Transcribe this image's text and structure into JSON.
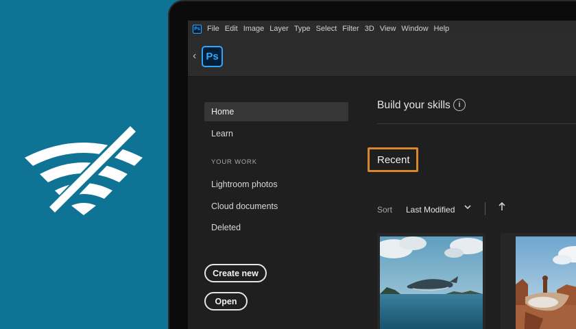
{
  "menubar": {
    "app_icon": "Ps",
    "items": [
      "File",
      "Edit",
      "Image",
      "Layer",
      "Type",
      "Select",
      "Filter",
      "3D",
      "View",
      "Window",
      "Help"
    ]
  },
  "appbar": {
    "logo_text": "Ps",
    "back_icon": "chevron-left-icon"
  },
  "sidebar": {
    "items": [
      {
        "label": "Home",
        "active": true
      },
      {
        "label": "Learn",
        "active": false
      }
    ],
    "section_label": "YOUR WORK",
    "work_items": [
      "Lightroom photos",
      "Cloud documents",
      "Deleted"
    ],
    "create_button": "Create new",
    "open_button": "Open"
  },
  "main": {
    "skills_title": "Build your skills",
    "info_icon": "i",
    "recent_title": "Recent",
    "sort_label": "Sort",
    "sort_value": "Last Modified"
  },
  "colors": {
    "brand_bg": "#0e7394",
    "ps_blue": "#31a8ff",
    "highlight": "#d9892b"
  }
}
